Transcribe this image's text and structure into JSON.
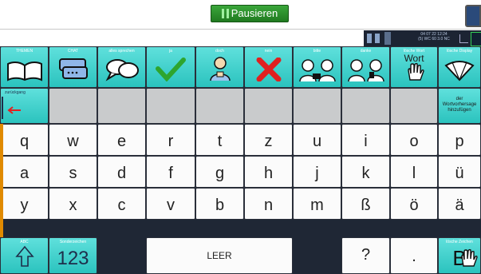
{
  "toolbar": {
    "pause_label": "Pausieren"
  },
  "status": {
    "line1": "04 07 22 12:24",
    "line2": "(5) WC 60 3.0 NC"
  },
  "categories": [
    {
      "label": "THEMEN",
      "icon": "book-icon"
    },
    {
      "label": "CHAT",
      "icon": "chat-icon"
    },
    {
      "label": "alles sprechen",
      "icon": "speech-bubbles-icon"
    },
    {
      "label": "ja",
      "icon": "checkmark-icon"
    },
    {
      "label": "doch",
      "icon": "thumbs-up-person-icon"
    },
    {
      "label": "nein",
      "icon": "cross-icon"
    },
    {
      "label": "bitte",
      "icon": "people-giving-icon"
    },
    {
      "label": "danke",
      "icon": "people-thanking-icon"
    },
    {
      "label": "lösche Wort",
      "word": "Wort",
      "icon": "hand-delete-icon"
    },
    {
      "label": "lösche Display",
      "icon": "fan-icon"
    }
  ],
  "row2": {
    "back_label": "zurückgang",
    "add_word": "der Wortvorhersage hinzufügen"
  },
  "rows": [
    [
      "q",
      "w",
      "e",
      "r",
      "t",
      "z",
      "u",
      "i",
      "o",
      "p"
    ],
    [
      "a",
      "s",
      "d",
      "f",
      "g",
      "h",
      "j",
      "k",
      "l",
      "ü"
    ],
    [
      "y",
      "x",
      "c",
      "v",
      "b",
      "n",
      "m",
      "ß",
      "ö",
      "ä"
    ]
  ],
  "bottom": {
    "abc_label": "ABC",
    "special_label": "Sonderzeichen",
    "digits": "123",
    "space": "LEER",
    "question": "?",
    "period": ".",
    "delete_char_label": "lösche Zeichen",
    "delete_char_letter": "B"
  }
}
